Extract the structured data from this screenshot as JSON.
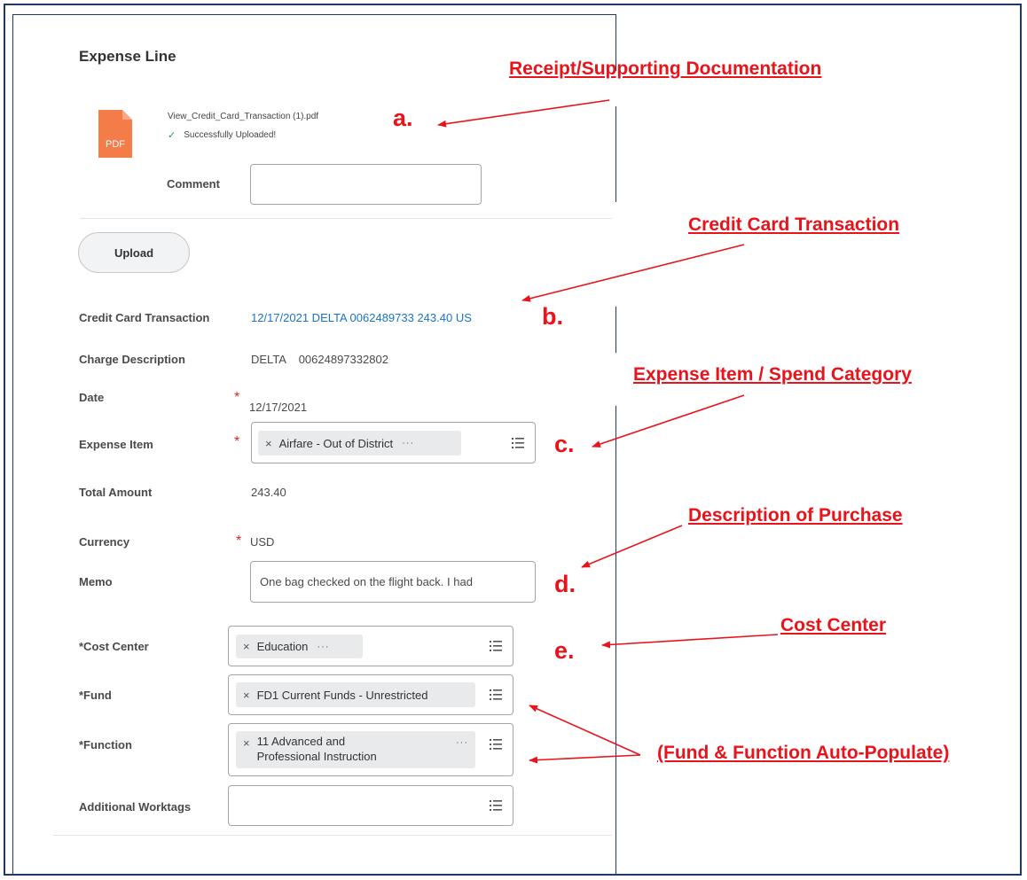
{
  "form": {
    "title": "Expense Line",
    "attachment": {
      "icon_text": "PDF",
      "file_name": "View_Credit_Card_Transaction (1).pdf",
      "status": "Successfully Uploaded!"
    },
    "comment_label": "Comment",
    "comment_value": "",
    "upload_label": "Upload",
    "fields": {
      "credit_card_label": "Credit Card Transaction",
      "credit_card_value": "12/17/2021 DELTA 0062489733 243.40 US",
      "charge_desc_label": "Charge Description",
      "charge_desc_value": "DELTA    00624897332802",
      "date_label": "Date",
      "date_value": "12/17/2021",
      "expense_item_label": "Expense Item",
      "expense_item_value": "Airfare - Out of District",
      "total_amount_label": "Total Amount",
      "total_amount_value": "243.40",
      "currency_label": "Currency",
      "currency_value": "USD",
      "memo_label": "Memo",
      "memo_value": "One bag checked on the flight back.  I had",
      "cost_center_label": "*Cost Center",
      "cost_center_value": "Education",
      "fund_label": "*Fund",
      "fund_value": "FD1 Current Funds - Unrestricted",
      "function_label": "*Function",
      "function_value_line1": "11 Advanced and",
      "function_value_line2": "Professional Instruction",
      "worktags_label": "Additional Worktags",
      "required_mark": "*",
      "remove_mark": "×",
      "more_mark": "···"
    }
  },
  "annotations": {
    "receipt": "Receipt/Supporting Documentation",
    "credit_card": "Credit Card Transaction",
    "expense_item": "Expense Item / Spend Category",
    "description": "Description of Purchase",
    "cost_center": "Cost Center",
    "fund_function": "(Fund & Function Auto-Populate)",
    "letter_a": "a.",
    "letter_b": "b.",
    "letter_c": "c.",
    "letter_d": "d.",
    "letter_e": "e."
  },
  "colors": {
    "annotation_red": "#e8131b",
    "link_blue": "#1a73c9",
    "pdf_orange": "#f47c48",
    "frame_navy": "#1f3864"
  },
  "icons": {
    "file": "pdf-file-icon",
    "status": "checkmark-icon",
    "prompt": "list-icon"
  }
}
